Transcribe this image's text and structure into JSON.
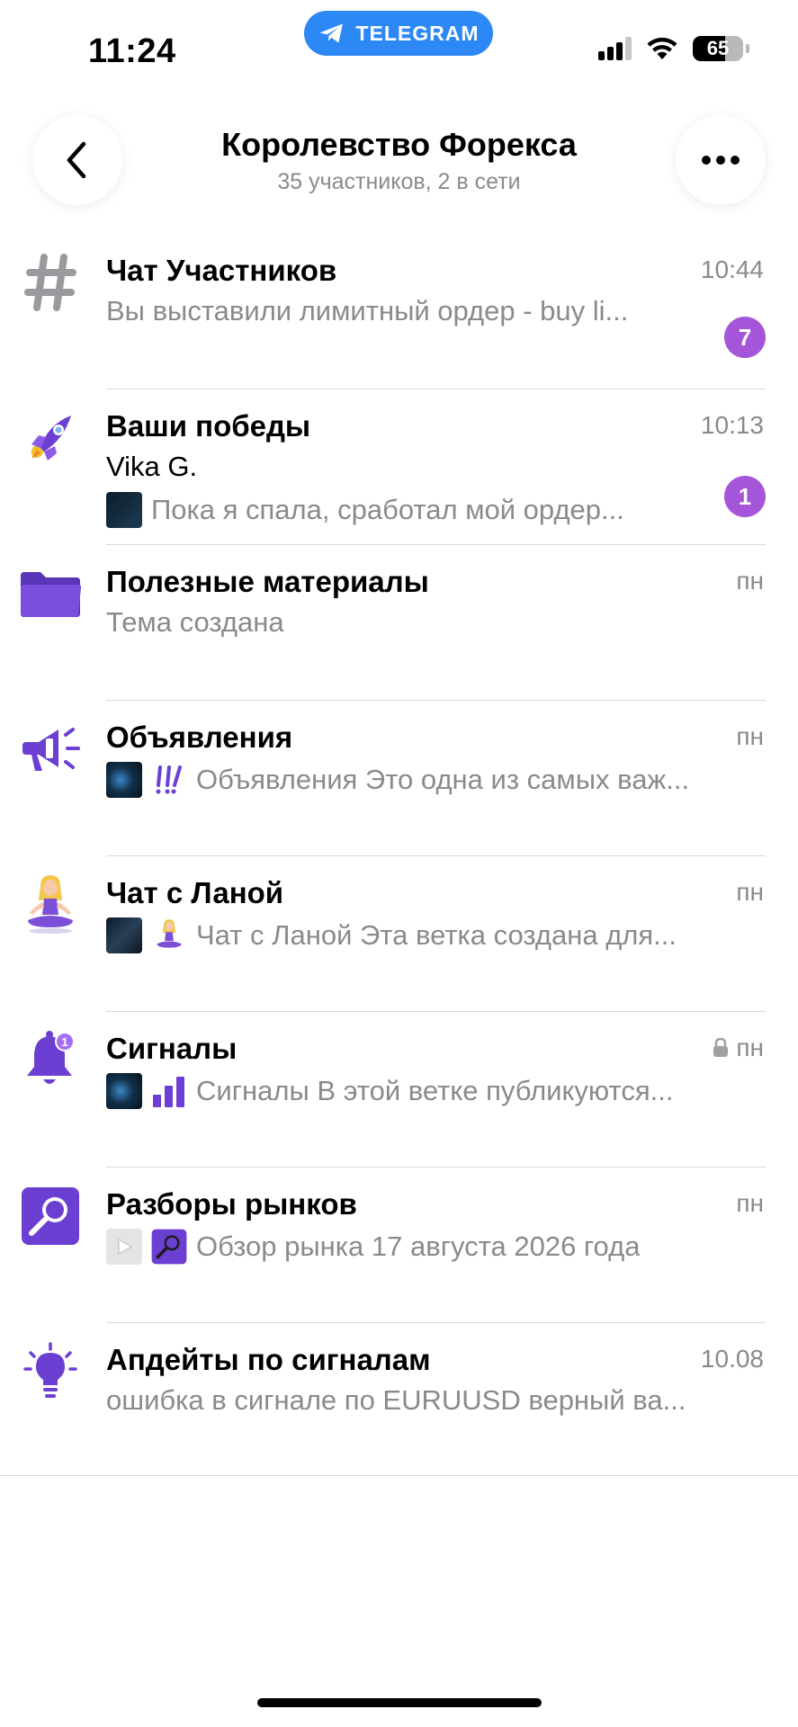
{
  "status_bar": {
    "time": "11:24",
    "app_pill": "TELEGRAM",
    "battery": "65",
    "battery_level": 0.65
  },
  "header": {
    "title": "Королевство Форекса",
    "subtitle": "35 участников, 2 в сети"
  },
  "topics": [
    {
      "title": "Чат Участников",
      "time": "10:44",
      "line1": "Вы выставили лимитный ордер - buy li...",
      "badge": "7",
      "icon": "hash-icon"
    },
    {
      "title": "Ваши победы",
      "time": "10:13",
      "sender": "Vika G.",
      "line2": "Пока я спала, сработал мой ордер...",
      "badge": "1",
      "icon": "rocket-icon"
    },
    {
      "title": "Полезные материалы",
      "time": "пн",
      "line1": "Тема создана",
      "icon": "folder-icon"
    },
    {
      "title": "Объявления",
      "time": "пн",
      "line1": "Объявления Это одна из самых важ...",
      "icon": "megaphone-icon",
      "mini_icon": "exclamation-icon"
    },
    {
      "title": "Чат с Ланой",
      "time": "пн",
      "line1": "Чат с Ланой Эта ветка создана для...",
      "icon": "meditation-icon",
      "mini_icon": "meditation-icon"
    },
    {
      "title": "Сигналы",
      "time": "пн",
      "locked": true,
      "line1": "Сигналы В этой ветке публикуются...",
      "icon": "bell-icon",
      "mini_icon": "bar-chart-icon"
    },
    {
      "title": "Разборы рынков",
      "time": "пн",
      "line1": "Обзор рынка 17 августа 2026 года",
      "icon": "magnifier-icon",
      "mini_icon": "magnifier-icon"
    },
    {
      "title": "Апдейты по сигналам",
      "time": "10.08",
      "line1": "ошибка в сигнале по EURUUSD верный ва...",
      "icon": "lightbulb-icon"
    }
  ],
  "colors": {
    "accent_purple": "#6b3fd1",
    "badge_purple": "#a555d9",
    "telegram_blue": "#2c88f4",
    "secondary_text": "#8a8a8e"
  }
}
